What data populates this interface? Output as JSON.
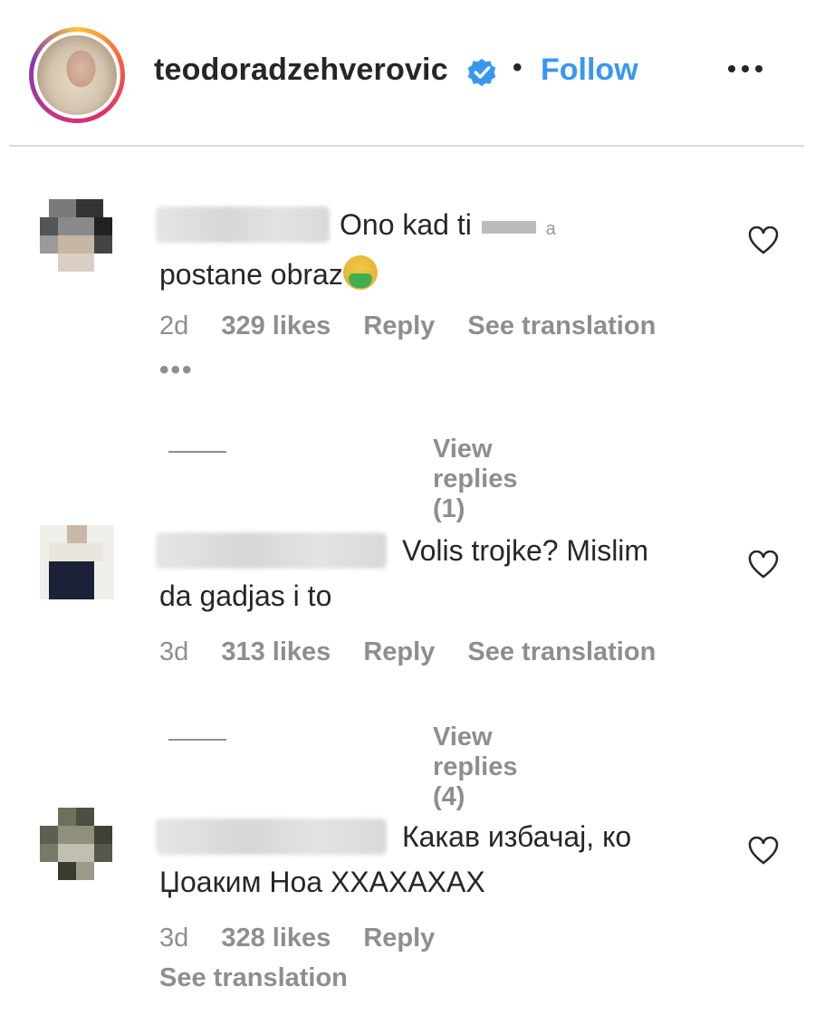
{
  "header": {
    "username": "teodoradzehverovic",
    "separator": "•",
    "follow_label": "Follow",
    "verified_icon": "verified-badge-icon",
    "more_icon": "more-options-icon",
    "accent_color": "#3897f0"
  },
  "comments": [
    {
      "text_line1": "Ono kad ti",
      "text_line1_suffix": "a",
      "text_line2": "postane obraz",
      "emoji": "face-vomiting-icon",
      "time": "2d",
      "likes": "329 likes",
      "reply": "Reply",
      "translation": "See translation",
      "more": "•••",
      "view_replies": "View replies (1)"
    },
    {
      "text_line1": "Volis trojke? Mislim",
      "text_line2": "da gadjas i to",
      "time": "3d",
      "likes": "313 likes",
      "reply": "Reply",
      "translation": "See translation",
      "view_replies": "View replies (4)"
    },
    {
      "text_line1": "Какав избачај, ко",
      "text_line2": "Џоаким Ноа ХХАХАХАХ",
      "time": "3d",
      "likes": "328 likes",
      "reply": "Reply",
      "translation": "See translation"
    }
  ]
}
